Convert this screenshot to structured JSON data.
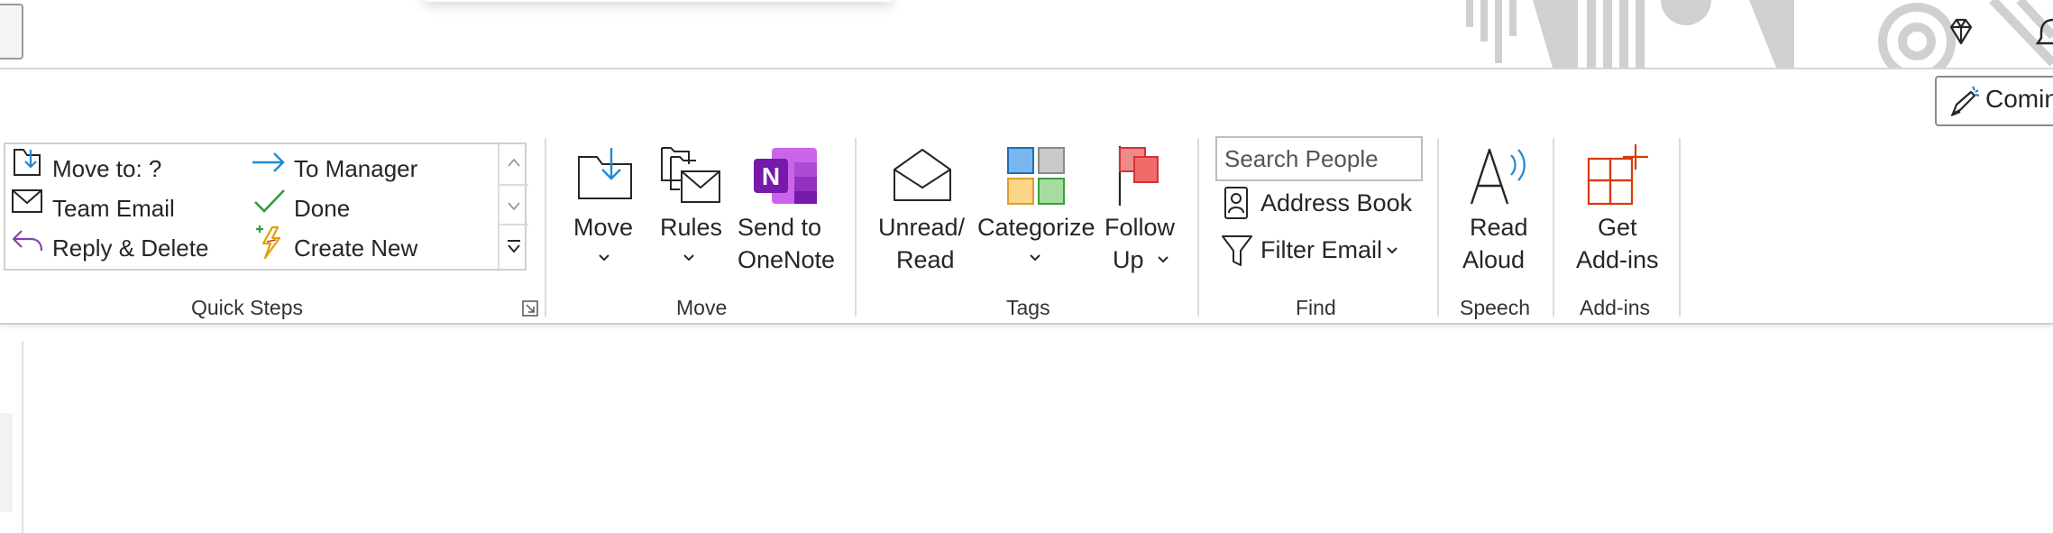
{
  "header": {
    "coming_soon_label": "Comin"
  },
  "ribbon": {
    "quick_steps": {
      "label": "Quick Steps",
      "items": [
        {
          "label": "Move to: ?",
          "icon": "move-to-folder-icon"
        },
        {
          "label": "Team Email",
          "icon": "envelope-icon"
        },
        {
          "label": "Reply & Delete",
          "icon": "reply-icon"
        },
        {
          "label": "To Manager",
          "icon": "arrow-right-icon"
        },
        {
          "label": "Done",
          "icon": "checkmark-icon"
        },
        {
          "label": "Create New",
          "icon": "lightning-plus-icon"
        }
      ]
    },
    "move": {
      "label": "Move",
      "move_label": "Move",
      "rules_label": "Rules",
      "onenote_line1": "Send to",
      "onenote_line2": "OneNote",
      "onenote_letter": "N"
    },
    "tags": {
      "label": "Tags",
      "unread_line1": "Unread/",
      "unread_line2": "Read",
      "categorize_label": "Categorize",
      "follow_line1": "Follow",
      "follow_line2": "Up"
    },
    "find": {
      "label": "Find",
      "search_placeholder": "Search People",
      "address_book_label": "Address Book",
      "filter_email_label": "Filter Email"
    },
    "speech": {
      "label": "Speech",
      "read_line1": "Read",
      "read_line2": "Aloud"
    },
    "addins": {
      "label": "Add-ins",
      "get_line1": "Get",
      "get_line2": "Add-ins"
    }
  },
  "colors": {
    "accent_blue": "#1e8ad6",
    "onenote_purple": "#7719aa",
    "follow_red": "#e04848",
    "addins_orange": "#d83b01",
    "check_green": "#2e9e3e",
    "reply_purple": "#8a3fae"
  }
}
